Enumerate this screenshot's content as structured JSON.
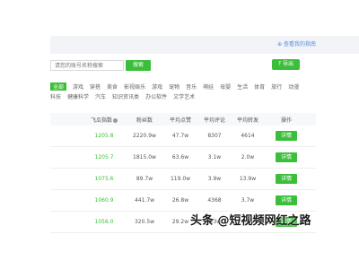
{
  "header": {
    "small_link": "⊕ 查看我的指南"
  },
  "search": {
    "placeholder": "请您的账号名称搜索",
    "button": "搜索"
  },
  "export_button": "导出",
  "filters": {
    "row1": [
      "全部",
      "游戏",
      "穿搭",
      "美食",
      "影视娱乐",
      "游戏",
      "宠物",
      "音乐",
      "萌娃",
      "母婴",
      "生活",
      "体育",
      "旅行",
      "动漫"
    ],
    "row2": [
      "科技",
      "健康科学",
      "汽车",
      "知识资讯类",
      "办公软件",
      "文学艺术"
    ],
    "active_index": 0
  },
  "table": {
    "headers": [
      "",
      "飞瓜指数",
      "粉丝数",
      "平均点赞",
      "平均评论",
      "平均转发",
      "操作"
    ],
    "rows": [
      {
        "index": "1205.8",
        "fans": "2220.9w",
        "likes": "47.7w",
        "comments": "8307",
        "shares": "4614",
        "action": "详情"
      },
      {
        "index": "1205.7",
        "fans": "1815.0w",
        "likes": "63.6w",
        "comments": "3.1w",
        "shares": "2.0w",
        "action": "详情"
      },
      {
        "index": "1075.6",
        "fans": "89.7w",
        "likes": "119.0w",
        "comments": "3.9w",
        "shares": "13.9w",
        "action": "详情"
      },
      {
        "index": "1060.9",
        "fans": "441.7w",
        "likes": "26.8w",
        "comments": "4368",
        "shares": "3.7w",
        "action": "详情"
      },
      {
        "index": "1056.0",
        "fans": "320.5w",
        "likes": "29.2w",
        "comments": "9.3w",
        "shares": "4.9w",
        "action": "详情"
      }
    ]
  },
  "watermark": "头条 @短视频网红之路",
  "colors": {
    "accent": "#3bbf3b"
  }
}
